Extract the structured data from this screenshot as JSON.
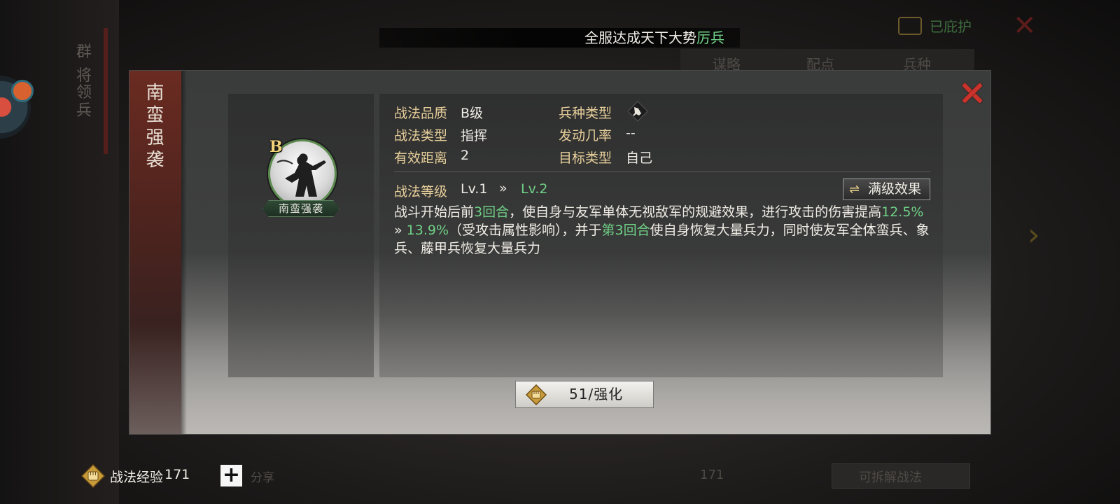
{
  "notice": {
    "text": "全服达成天下大势",
    "highlight": "厉兵"
  },
  "background": {
    "side_tabs": [
      "群",
      "将",
      "领",
      "兵"
    ],
    "tabs": [
      "谋略",
      "配点",
      "兵种"
    ],
    "top_right_status": "已庇护",
    "bottom_right_button": "可拆解战法",
    "bottom_right_value": "171",
    "share_label": "分享"
  },
  "tactic": {
    "name": "南蛮强袭",
    "name_vertical": [
      "南",
      "蛮",
      "强",
      "袭"
    ],
    "grade": "B",
    "attributes": [
      {
        "label": "战法品质",
        "value": "B级"
      },
      {
        "label": "战法类型",
        "value": "指挥"
      },
      {
        "label": "有效距离",
        "value": "2"
      },
      {
        "label": "兵种类型",
        "value": "",
        "icon": "troop-type-icon"
      },
      {
        "label": "发动几率",
        "value": "--"
      },
      {
        "label": "目标类型",
        "value": "自己"
      }
    ],
    "level": {
      "label": "战法等级",
      "from": "Lv.1",
      "arrow": "»",
      "to": "Lv.2"
    },
    "max_effect_button": "满级效果",
    "description": {
      "p1": "战斗开始后前",
      "g1": "3回合",
      "p2": "，使自身与友军单体无视敌军的规避效果，进行攻击的伤害提高",
      "g2": "12.5%",
      "arrow": " » ",
      "g3": "13.9%",
      "p3": "（受攻击属性影响），并于",
      "g4": "第3回合",
      "p4": "使自身恢复大量兵力，同时使友军全体蛮兵、象兵、藤甲兵恢复大量兵力"
    },
    "enhance_button": "51/强化"
  },
  "footer": {
    "exp_label": "战法经验",
    "exp_value": "171",
    "plus": "+"
  },
  "colors": {
    "accent_green": "#6fd186",
    "label_gold": "#e7cf9a",
    "close_red": "#c9332b",
    "banner_red": "#6a2b21"
  }
}
